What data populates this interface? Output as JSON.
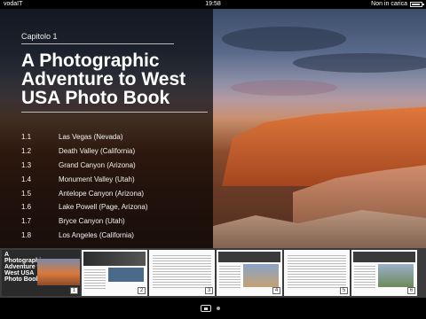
{
  "status_bar": {
    "carrier": "vodaIT",
    "time": "19:58",
    "charging": "Non in carica"
  },
  "content": {
    "chapter": "Capitolo 1",
    "title": "A Photographic Adventure to West USA Photo Book",
    "toc": [
      {
        "num": "1.1",
        "label": "Las Vegas (Nevada)"
      },
      {
        "num": "1.2",
        "label": "Death Valley (California)"
      },
      {
        "num": "1.3",
        "label": "Grand Canyon (Arizona)"
      },
      {
        "num": "1.4",
        "label": "Monument Valley (Utah)"
      },
      {
        "num": "1.5",
        "label": "Antelope Canyon (Arizona)"
      },
      {
        "num": "1.6",
        "label": "Lake Powell (Page, Arizona)"
      },
      {
        "num": "1.7",
        "label": "Bryce Canyon (Utah)"
      },
      {
        "num": "1.8",
        "label": "Los Angeles (California)"
      }
    ]
  },
  "thumbnails": {
    "cover_title": "A Photographic Adventure to West USA Photo Book",
    "pages": [
      "1",
      "2",
      "3",
      "4",
      "5",
      "6"
    ]
  },
  "pager": {
    "current_page": 1
  }
}
